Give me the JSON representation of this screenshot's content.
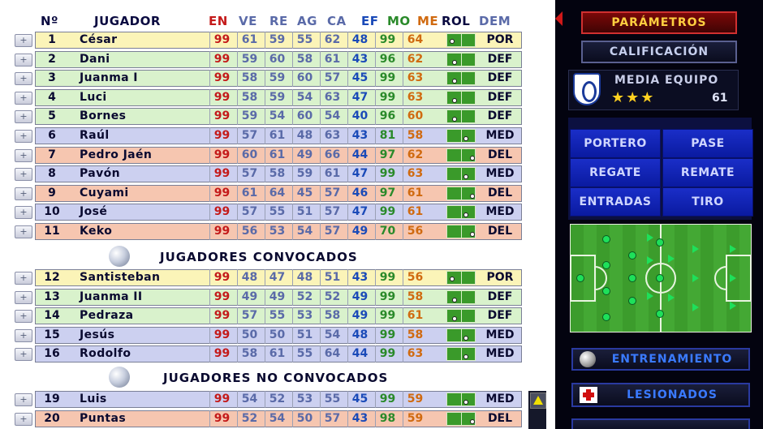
{
  "header": {
    "num": "Nº",
    "player": "JUGADOR",
    "stats": [
      "EN",
      "VE",
      "RE",
      "AG",
      "CA",
      "EF",
      "MO",
      "ME"
    ],
    "stat_colors": [
      "#c41a1a",
      "#5a6aa8",
      "#5a6aa8",
      "#5a6aa8",
      "#5a6aa8",
      "#1a4ab8",
      "#2a8a2a",
      "#d06a10"
    ],
    "rol": "ROL",
    "dem": "DEM"
  },
  "starters": [
    {
      "num": "1",
      "name": "César",
      "stats": [
        "99",
        "61",
        "59",
        "55",
        "62",
        "48",
        "99",
        "64"
      ],
      "role": "POR"
    },
    {
      "num": "2",
      "name": "Dani",
      "stats": [
        "99",
        "59",
        "60",
        "58",
        "61",
        "43",
        "96",
        "62"
      ],
      "role": "DEF"
    },
    {
      "num": "3",
      "name": "Juanma I",
      "stats": [
        "99",
        "58",
        "59",
        "60",
        "57",
        "45",
        "99",
        "63"
      ],
      "role": "DEF"
    },
    {
      "num": "4",
      "name": "Luci",
      "stats": [
        "99",
        "58",
        "59",
        "54",
        "63",
        "47",
        "99",
        "63"
      ],
      "role": "DEF"
    },
    {
      "num": "5",
      "name": "Bornes",
      "stats": [
        "99",
        "59",
        "54",
        "60",
        "54",
        "40",
        "96",
        "60"
      ],
      "role": "DEF"
    },
    {
      "num": "6",
      "name": "Raúl",
      "stats": [
        "99",
        "57",
        "61",
        "48",
        "63",
        "43",
        "81",
        "58"
      ],
      "role": "MED"
    },
    {
      "num": "7",
      "name": "Pedro Jaén",
      "stats": [
        "99",
        "60",
        "61",
        "49",
        "66",
        "44",
        "97",
        "62"
      ],
      "role": "DEL"
    },
    {
      "num": "8",
      "name": "Pavón",
      "stats": [
        "99",
        "57",
        "58",
        "59",
        "61",
        "47",
        "99",
        "63"
      ],
      "role": "MED"
    },
    {
      "num": "9",
      "name": "Cuyami",
      "stats": [
        "99",
        "61",
        "64",
        "45",
        "57",
        "46",
        "97",
        "61"
      ],
      "role": "DEL"
    },
    {
      "num": "10",
      "name": "José",
      "stats": [
        "99",
        "57",
        "55",
        "51",
        "57",
        "47",
        "99",
        "61"
      ],
      "role": "MED"
    },
    {
      "num": "11",
      "name": "Keko",
      "stats": [
        "99",
        "56",
        "53",
        "54",
        "57",
        "49",
        "70",
        "56"
      ],
      "role": "DEL"
    }
  ],
  "convocados_title": "JUGADORES CONVOCADOS",
  "convocados": [
    {
      "num": "12",
      "name": "Santisteban",
      "stats": [
        "99",
        "48",
        "47",
        "48",
        "51",
        "43",
        "99",
        "56"
      ],
      "role": "POR"
    },
    {
      "num": "13",
      "name": "Juanma II",
      "stats": [
        "99",
        "49",
        "49",
        "52",
        "52",
        "49",
        "99",
        "58"
      ],
      "role": "DEF"
    },
    {
      "num": "14",
      "name": "Pedraza",
      "stats": [
        "99",
        "57",
        "55",
        "53",
        "58",
        "49",
        "99",
        "61"
      ],
      "role": "DEF"
    },
    {
      "num": "15",
      "name": "Jesús",
      "stats": [
        "99",
        "50",
        "50",
        "51",
        "54",
        "48",
        "99",
        "58"
      ],
      "role": "MED"
    },
    {
      "num": "16",
      "name": "Rodolfo",
      "stats": [
        "99",
        "58",
        "61",
        "55",
        "64",
        "44",
        "99",
        "63"
      ],
      "role": "MED"
    }
  ],
  "no_convocados_title": "JUGADORES NO CONVOCADOS",
  "no_convocados": [
    {
      "num": "19",
      "name": "Luis",
      "stats": [
        "99",
        "54",
        "52",
        "53",
        "55",
        "45",
        "99",
        "59"
      ],
      "role": "MED"
    },
    {
      "num": "20",
      "name": "Puntas",
      "stats": [
        "99",
        "52",
        "54",
        "50",
        "57",
        "43",
        "98",
        "59"
      ],
      "role": "DEL"
    }
  ],
  "side": {
    "parametros": "PARÁMETROS",
    "calificacion": "CALIFICACIÓN",
    "media_label": "MEDIA EQUIPO",
    "media_stars": "★★★",
    "media_value": "61",
    "tiles": [
      "PORTERO",
      "PASE",
      "REGATE",
      "REMATE",
      "ENTRADAS",
      "TIRO"
    ],
    "entrenamiento": "ENTRENAMIENTO",
    "lesionados": "LESIONADOS"
  }
}
